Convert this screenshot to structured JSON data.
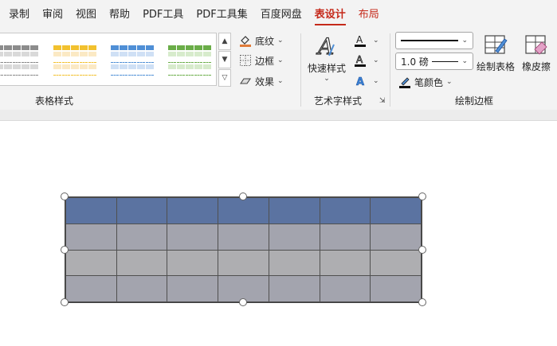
{
  "tabs": [
    {
      "label": "录制"
    },
    {
      "label": "审阅"
    },
    {
      "label": "视图"
    },
    {
      "label": "帮助"
    },
    {
      "label": "PDF工具"
    },
    {
      "label": "PDF工具集"
    },
    {
      "label": "百度网盘"
    },
    {
      "label": "表设计"
    },
    {
      "label": "布局"
    }
  ],
  "ribbon": {
    "table_styles": {
      "group_label": "表格样式",
      "swatch_colors": [
        "#8c8c8c",
        "#f2c12e",
        "#4f8fd6",
        "#6aad48"
      ],
      "shading_label": "底纹",
      "borders_label": "边框",
      "effects_label": "效果"
    },
    "wordart": {
      "group_label": "艺术字样式",
      "quick_styles_label": "快速样式",
      "text_fill_icon": "text-fill-icon",
      "text_outline_icon": "text-outline-icon",
      "text_effects_icon": "text-effects-icon"
    },
    "draw_borders": {
      "group_label": "绘制边框",
      "pen_style": "",
      "pen_weight": "1.0 磅",
      "pen_color_label": "笔颜色",
      "draw_table_label": "绘制表格",
      "eraser_label": "橡皮擦"
    }
  },
  "colors": {
    "accent": "#c5291a",
    "header_row": "#5b73a1",
    "body_row": "#a3a4ae",
    "body_row_alt": "#aeaeb1"
  },
  "document": {
    "table": {
      "rows": 4,
      "columns": 7
    }
  }
}
